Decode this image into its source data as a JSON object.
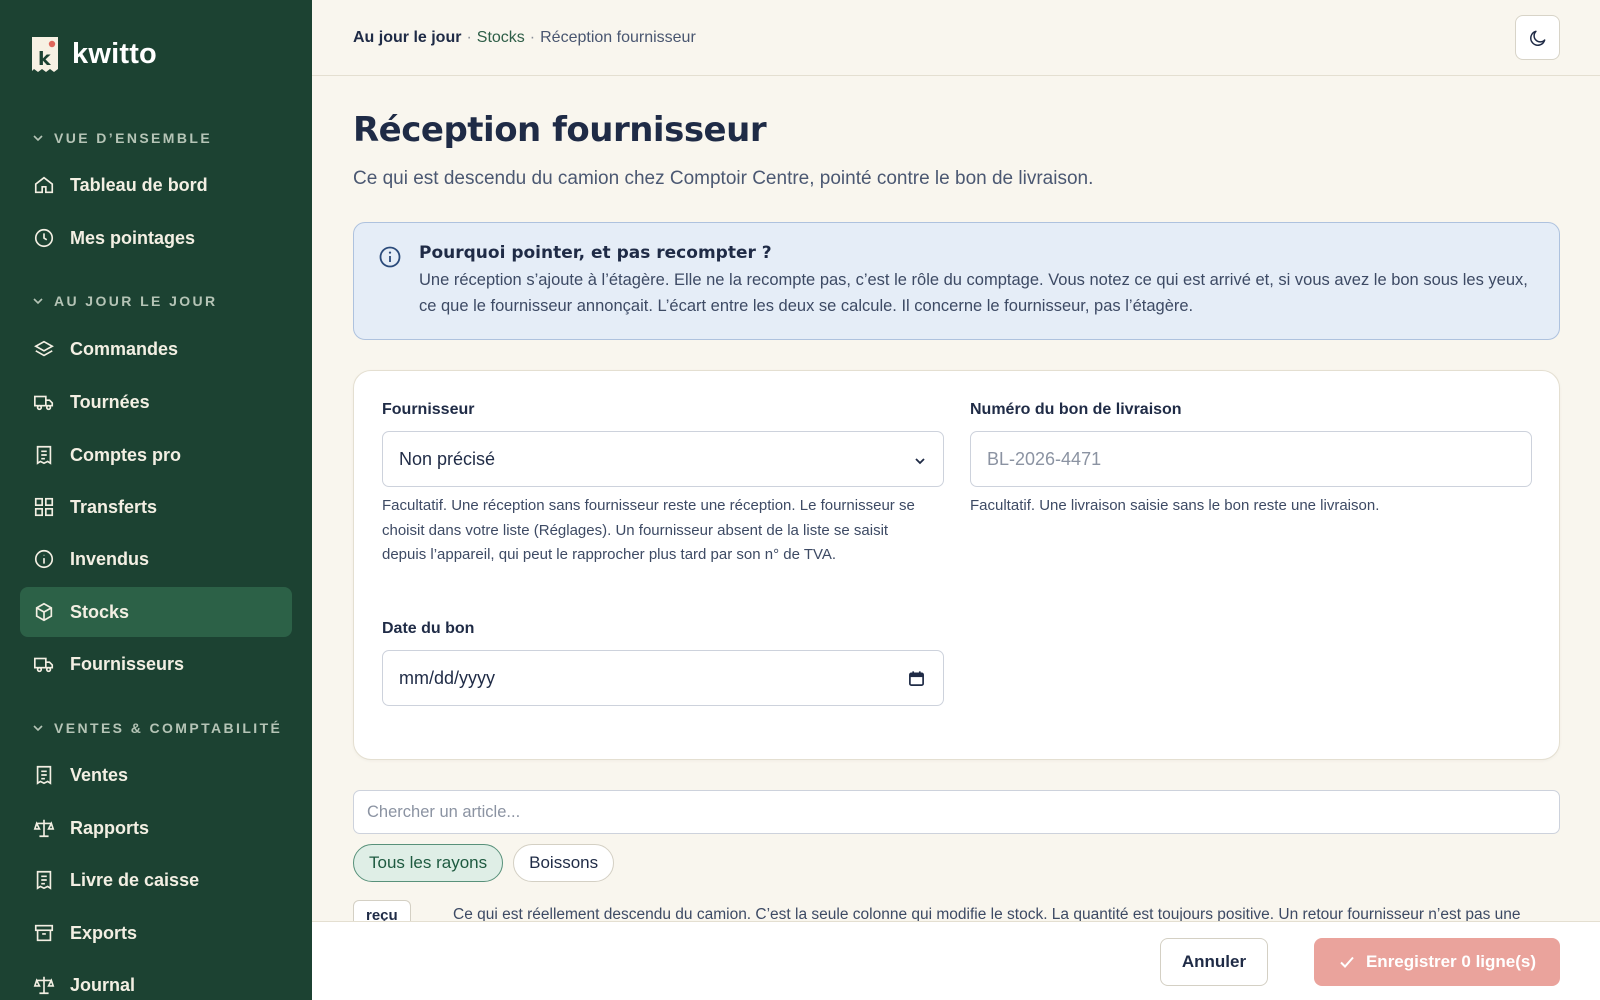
{
  "app": {
    "name": "kwitto",
    "logo_letter": "k"
  },
  "colors": {
    "sidebar_bg": "#1c4232",
    "sidebar_active": "#2c6147",
    "accent_green": "#2e5e47",
    "save_button": "#eaa39c",
    "info_bg": "#e5edf7"
  },
  "sidebar": {
    "sections": [
      {
        "title": "VUE D’ENSEMBLE",
        "items": [
          {
            "label": "Tableau de bord",
            "icon": "home-icon"
          },
          {
            "label": "Mes pointages",
            "icon": "clock-icon"
          }
        ]
      },
      {
        "title": "AU JOUR LE JOUR",
        "items": [
          {
            "label": "Commandes",
            "icon": "layers-icon"
          },
          {
            "label": "Tournées",
            "icon": "truck-icon"
          },
          {
            "label": "Comptes pro",
            "icon": "receipt-icon"
          },
          {
            "label": "Transferts",
            "icon": "grid-icon"
          },
          {
            "label": "Invendus",
            "icon": "info-icon"
          },
          {
            "label": "Stocks",
            "icon": "box-icon",
            "active": true
          },
          {
            "label": "Fournisseurs",
            "icon": "truck-icon"
          }
        ]
      },
      {
        "title": "VENTES & COMPTABILITÉ",
        "items": [
          {
            "label": "Ventes",
            "icon": "receipt-icon"
          },
          {
            "label": "Rapports",
            "icon": "scale-icon"
          },
          {
            "label": "Livre de caisse",
            "icon": "receipt-icon"
          },
          {
            "label": "Exports",
            "icon": "archive-icon"
          },
          {
            "label": "Journal",
            "icon": "scale-icon"
          }
        ]
      }
    ]
  },
  "breadcrumb": {
    "root": "Au jour le jour",
    "separator": "·",
    "section": "Stocks",
    "current": "Réception fournisseur"
  },
  "header": {
    "theme_toggle_icon": "moon-icon"
  },
  "page": {
    "title": "Réception fournisseur",
    "subtitle": "Ce qui est descendu du camion chez Comptoir Centre, pointé contre le bon de livraison."
  },
  "info": {
    "title": "Pourquoi pointer, et pas recompter ?",
    "line1": "Une réception s’ajoute à l’étagère. Elle ne la recompte pas, c’est le rôle du comptage. Vous notez ce qui est arrivé et, si vous avez le bon sous les yeux,",
    "line2": "ce que le fournisseur annonçait. L’écart entre les deux se calcule. Il concerne le fournisseur, pas l’étagère."
  },
  "form": {
    "supplier": {
      "label": "Fournisseur",
      "value": "Non précisé",
      "hint_line1": "Facultatif. Une réception sans fournisseur reste une réception. Le fournisseur se",
      "hint_line2": "choisit dans votre liste (Réglages). Un fournisseur absent de la liste se saisit",
      "hint_line3": "depuis l’appareil, qui peut le rapprocher plus tard par son n° de TVA."
    },
    "delivery_note": {
      "label": "Numéro du bon de livraison",
      "placeholder": "BL-2026-4471",
      "hint": "Facultatif. Une livraison saisie sans le bon reste une livraison."
    },
    "date": {
      "label": "Date du bon",
      "placeholder": "mm/dd/yyyy"
    }
  },
  "search": {
    "placeholder": "Chercher un article..."
  },
  "filters": {
    "chips": [
      "Tous les rayons",
      "Boissons"
    ],
    "active_index": 0
  },
  "legend": {
    "tag": "reçu",
    "text": "Ce qui est réellement descendu du camion. C’est la seule colonne qui modifie le stock. La quantité est toujours positive. Un retour fournisseur n’est pas une"
  },
  "footer": {
    "cancel_label": "Annuler",
    "save_label": "Enregistrer 0 ligne(s)"
  }
}
